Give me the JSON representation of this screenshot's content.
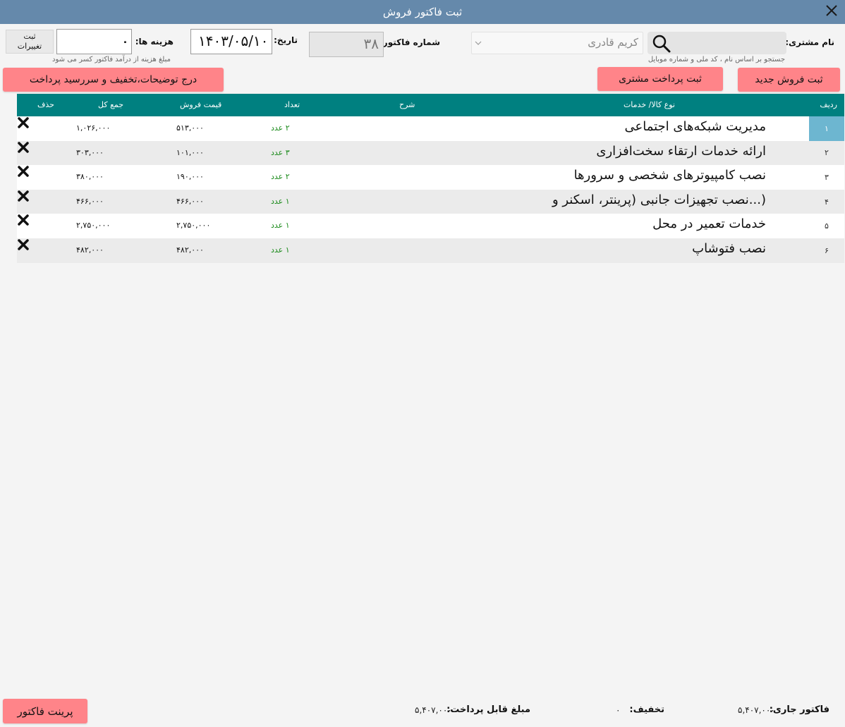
{
  "window": {
    "title": "ثبت فاکتور فروش"
  },
  "header": {
    "customer_label": "نام مشتری:",
    "customer_value": "کریم قادری",
    "customer_hint": "جستجو بر اساس نام ، کد ملی و شماره موبایل",
    "invoice_no_label": "شماره فاکتور:",
    "invoice_no": "۳۸",
    "date_label": "تاریخ:",
    "date": "۱۴۰۳/۰۵/۱۰",
    "cost_label": "هزینه ها:",
    "cost_value": "۰",
    "cost_hint": "مبلغ هزینه از درآمد فاکتور کسر می شود",
    "save_changes_line1": "ثبت",
    "save_changes_line2": "تغییرات"
  },
  "actions": {
    "new_sale": "ثبت فروش جدید",
    "customer_payment": "ثبت پرداخت مشتری",
    "details": "درج توضیحات،تخفیف و سررسید پرداخت",
    "print": "پرینت فاکتور"
  },
  "table": {
    "columns": {
      "row": "ردیف",
      "item": "نوع کالا/ خدمات",
      "desc": "شرح",
      "qty": "تعداد",
      "price": "قیمت فروش",
      "total": "جمع کل",
      "delete": "حذف"
    },
    "rows": [
      {
        "n": "۱",
        "item": "مدیریت شبکه‌های اجتماعی",
        "qty": "۲ عدد",
        "price": "۵۱۳,۰۰۰",
        "total": "۱,۰۲۶,۰۰۰"
      },
      {
        "n": "۲",
        "item": "ارائه خدمات ارتقاء سخت‌افزاری",
        "qty": "۳ عدد",
        "price": "۱۰۱,۰۰۰",
        "total": "۳۰۳,۰۰۰"
      },
      {
        "n": "۳",
        "item": "نصب کامپیوترهای شخصی و سرورها",
        "qty": "۲ عدد",
        "price": "۱۹۰,۰۰۰",
        "total": "۳۸۰,۰۰۰"
      },
      {
        "n": "۴",
        "item": "(...نصب تجهیزات جانبی (پرینتر، اسکنر و",
        "qty": "۱ عدد",
        "price": "۴۶۶,۰۰۰",
        "total": "۴۶۶,۰۰۰"
      },
      {
        "n": "۵",
        "item": "خدمات تعمیر در محل",
        "qty": "۱ عدد",
        "price": "۲,۷۵۰,۰۰۰",
        "total": "۲,۷۵۰,۰۰۰"
      },
      {
        "n": "۶",
        "item": "نصب فتوشاپ",
        "qty": "۱ عدد",
        "price": "۴۸۲,۰۰۰",
        "total": "۴۸۲,۰۰۰"
      }
    ]
  },
  "footer": {
    "current_label": "فاکتور جاری:",
    "current_value": "۵,۴۰۷,۰۰۰",
    "discount_label": "تخفیف:",
    "discount_value": "۰",
    "payable_label": "مبلغ قابل پرداخت:",
    "payable_value": "۵,۴۰۷,۰۰۰"
  },
  "colors": {
    "titlebar": "#6589ab",
    "header_row": "#008080",
    "accent_button": "#ff8489",
    "selected_row": "#6db6d0",
    "quantity_text": "#1a8a1a"
  }
}
